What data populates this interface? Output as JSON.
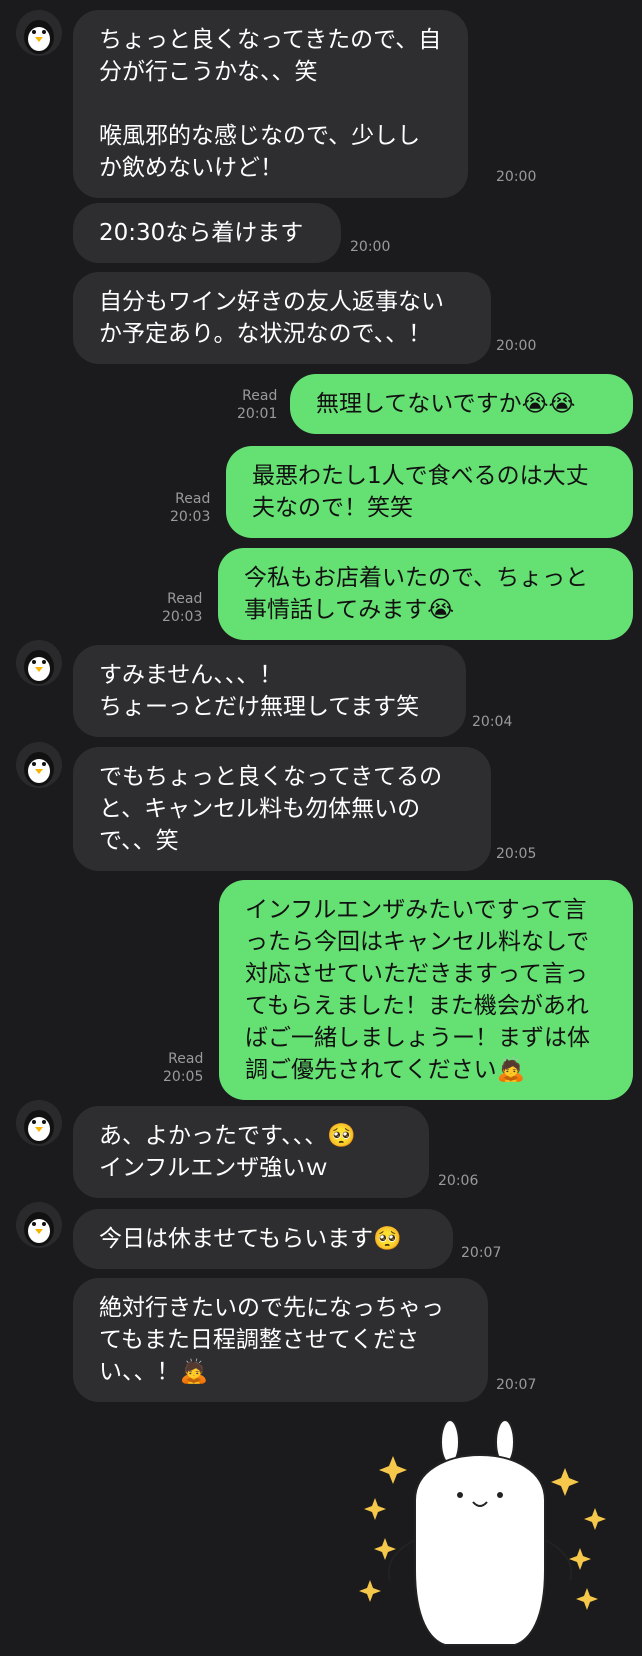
{
  "messages": [
    {
      "dir": "in",
      "avatar": true,
      "text": "ちょっと良くなってきたので、自分が行こうかな、、笑\n\n喉風邪的な感じなので、少ししか飲めないけど！",
      "time": "20:00"
    },
    {
      "dir": "in",
      "avatar": false,
      "text": "20:30なら着けます",
      "time": "20:00"
    },
    {
      "dir": "in",
      "avatar": false,
      "text": "自分もワイン好きの友人返事ないか予定あり。な状況なので、、！",
      "time": "20:00"
    },
    {
      "dir": "out",
      "read": "Read",
      "text": "無理してないですか😭😭",
      "time": "20:01"
    },
    {
      "dir": "out",
      "read": "Read",
      "text": "最悪わたし1人で食べるのは大丈夫なので！笑笑",
      "time": "20:03"
    },
    {
      "dir": "out",
      "read": "Read",
      "text": "今私もお店着いたので、ちょっと事情話してみます😭",
      "time": "20:03"
    },
    {
      "dir": "in",
      "avatar": true,
      "text": "すみません、、、！\nちょーっとだけ無理してます笑",
      "time": "20:04"
    },
    {
      "dir": "in",
      "avatar": true,
      "text": "でもちょっと良くなってきてるのと、キャンセル料も勿体無いので、、笑",
      "time": "20:05"
    },
    {
      "dir": "out",
      "read": "Read",
      "text": "インフルエンザみたいですって言ったら今回はキャンセル料なしで対応させていただきますって言ってもらえました！また機会があればご一緒しましょうー！まずは体調ご優先されてください🙇",
      "time": "20:05"
    },
    {
      "dir": "in",
      "avatar": true,
      "text": "あ、よかったです、、、🥺\nインフルエンザ強いｗ",
      "time": "20:06"
    },
    {
      "dir": "in",
      "avatar": true,
      "text": "今日は休ませてもらいます🥺",
      "time": "20:07"
    },
    {
      "dir": "in",
      "avatar": false,
      "text": "絶対行きたいので先になっちゃってもまた日程調整させてください、、！🙇",
      "time": "20:07"
    }
  ],
  "sticker": {
    "name": "bunny-sticker"
  },
  "colors": {
    "background": "#1b1b1d",
    "incoming": "#2e2e30",
    "outgoing": "#65e073",
    "timestamp": "#9a9a9a"
  }
}
